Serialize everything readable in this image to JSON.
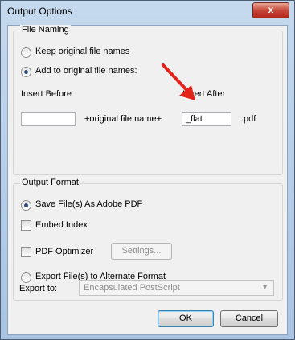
{
  "window": {
    "title": "Output Options",
    "close_label": "x"
  },
  "file_naming": {
    "group_label": "File Naming",
    "keep_label": "Keep original file names",
    "add_label": "Add to original file names:",
    "insert_before_label": "Insert Before",
    "insert_after_label": "Insert After",
    "insert_before_value": "",
    "middle_text": "+original file name+",
    "insert_after_value": "_flat",
    "extension": ".pdf"
  },
  "output_format": {
    "group_label": "Output Format",
    "save_pdf_label": "Save File(s) As Adobe PDF",
    "embed_index_label": "Embed Index",
    "pdf_optimizer_label": "PDF Optimizer",
    "settings_button": "Settings...",
    "export_alt_label": "Export File(s) to Alternate Format",
    "export_to_label": "Export to:",
    "export_to_value": "Encapsulated PostScript"
  },
  "buttons": {
    "ok": "OK",
    "cancel": "Cancel"
  },
  "colors": {
    "arrow": "#e2231a",
    "close_button": "#c7483a"
  },
  "icons": {
    "close": "close-icon",
    "arrow": "red-arrow-annotation"
  }
}
